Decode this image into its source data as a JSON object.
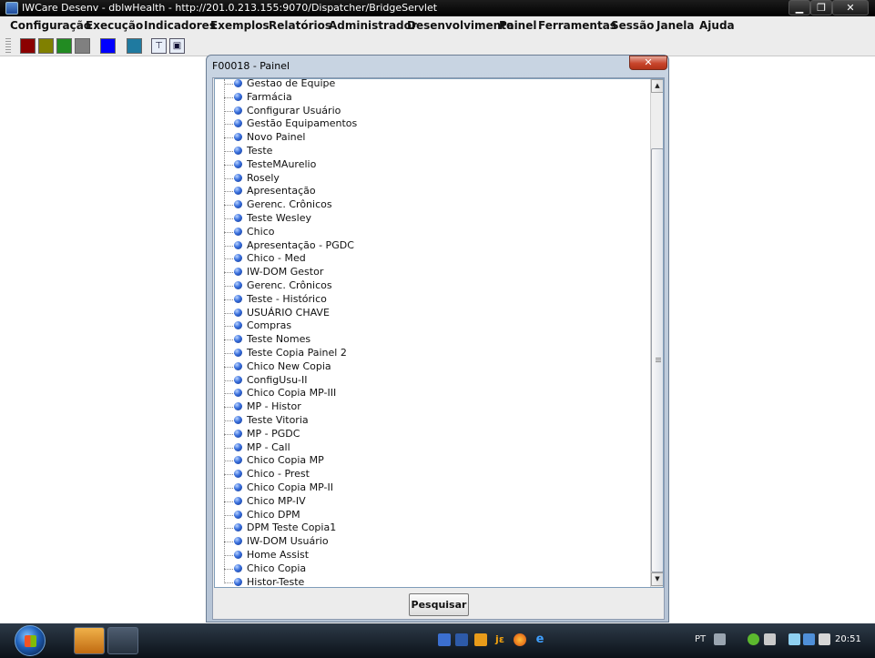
{
  "window": {
    "title": "IWCare Desenv - dblwHealth - http://201.0.213.155:9070/Dispatcher/BridgeServlet",
    "minimize": "▁",
    "maximize": "❐",
    "close": "✕"
  },
  "menu": [
    "Configuração",
    "Execução",
    "Indicadores",
    "Exemplos",
    "Relatórios",
    "Administrador",
    "Desenvolvimento",
    "Painel",
    "Ferramentas",
    "Sessão",
    "Janela",
    "Ajuda"
  ],
  "toolbar": {
    "swatches": [
      "#8b0000",
      "#808000",
      "#228b22",
      "#808080",
      "#0000ff",
      "#1f7aa0"
    ],
    "tree_button": "⊤",
    "cascade_button": "▣"
  },
  "dialog": {
    "title": "F00018 - Painel",
    "close": "✕",
    "items": [
      "Gestao de Equipe",
      "Farmácia",
      "Configurar Usuário",
      "Gestão Equipamentos",
      "Novo Painel",
      "Teste",
      "TesteMAurelio",
      "Rosely",
      "Apresentação",
      "Gerenc. Crônicos",
      "Teste Wesley",
      "Chico",
      "Apresentação - PGDC",
      "Chico - Med",
      "IW-DOM Gestor",
      "Gerenc. Crônicos",
      "Teste - Histórico",
      "USUÁRIO CHAVE",
      "Compras",
      "Teste Nomes",
      "Teste Copia Painel 2",
      "Chico New Copia",
      "ConfigUsu-II",
      "Chico Copia MP-III",
      "MP - Histor",
      "Teste Vitoria",
      "MP - PGDC",
      "MP - Call",
      "Chico Copia MP",
      "Chico - Prest",
      "Chico Copia MP-II",
      "Chico MP-IV",
      "Chico DPM",
      "DPM Teste Copia1",
      "IW-DOM Usuário",
      "Home Assist",
      "Chico Copia",
      "Histor-Teste"
    ],
    "search_button": "Pesquisar"
  },
  "taskbar": {
    "language": "PT",
    "clock": "20:51",
    "quick_icons": [
      "mail-icon",
      "desktop-icon",
      "media-icon",
      "java-icon",
      "firefox-icon",
      "ie-icon"
    ]
  }
}
